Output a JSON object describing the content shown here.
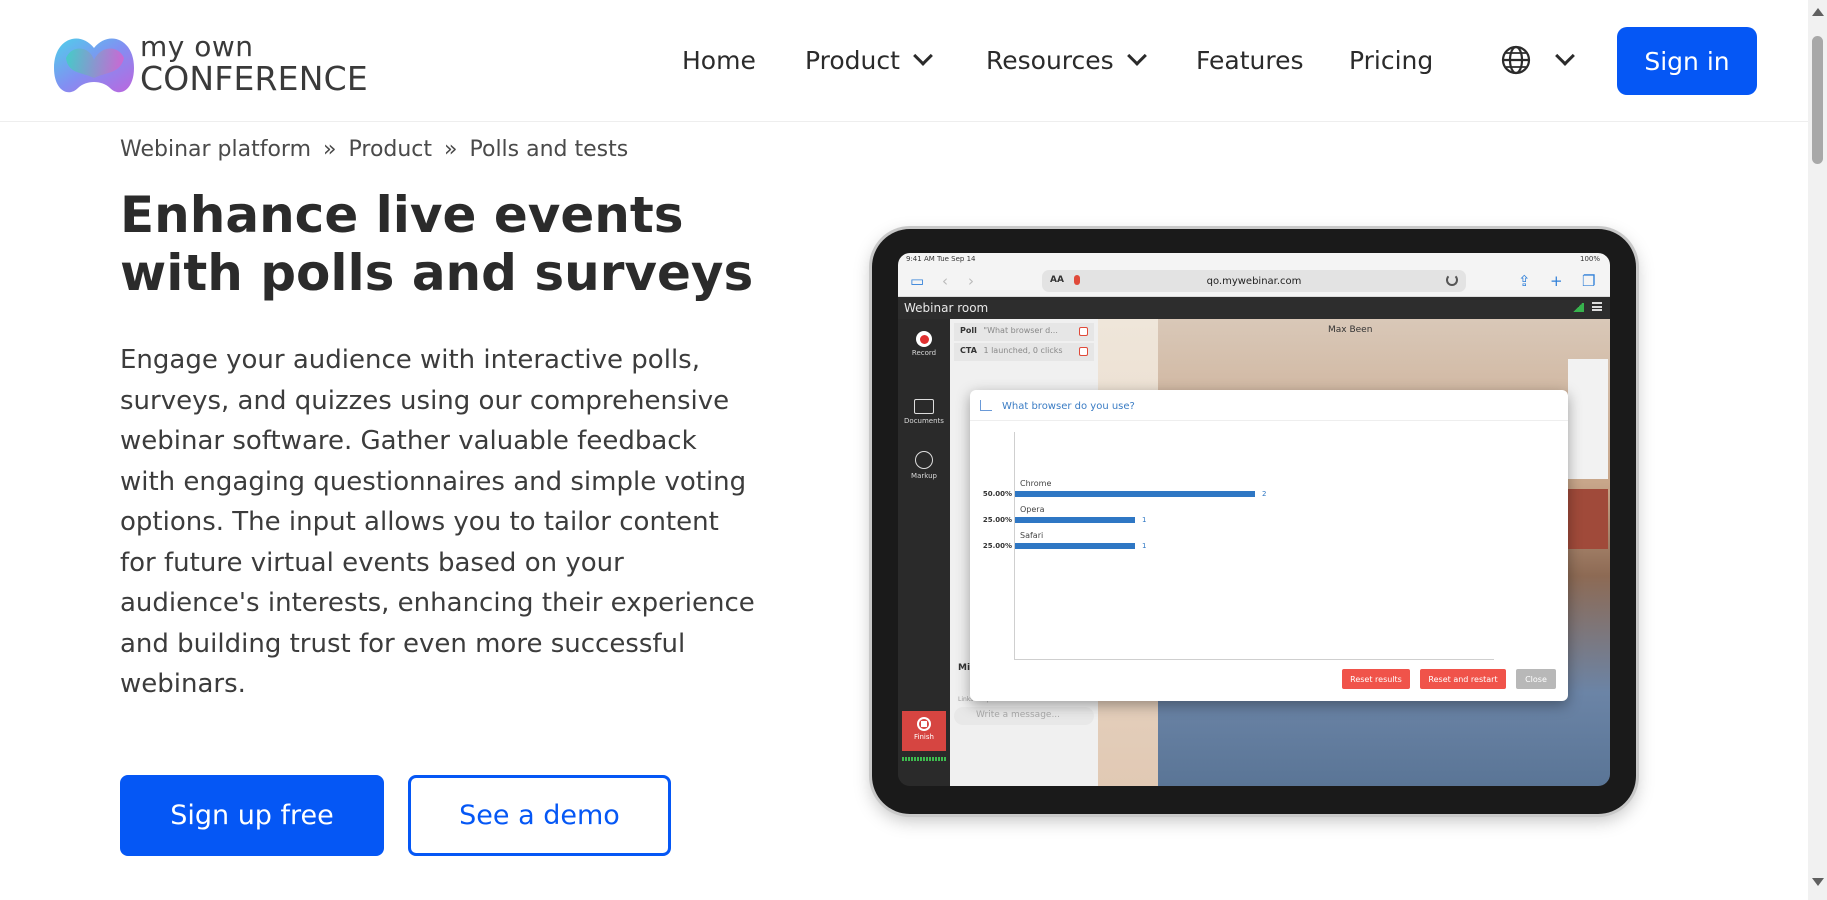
{
  "header": {
    "logo": {
      "line1": "my own",
      "line2": "CONFERENCE"
    },
    "nav": [
      {
        "label": "Home",
        "has_dropdown": false
      },
      {
        "label": "Product",
        "has_dropdown": true
      },
      {
        "label": "Resources",
        "has_dropdown": true
      },
      {
        "label": "Features",
        "has_dropdown": false
      },
      {
        "label": "Pricing",
        "has_dropdown": false
      }
    ],
    "language_icon": "globe-icon",
    "signin_label": "Sign in",
    "accent_color": "#0557f5"
  },
  "breadcrumb": [
    "Webinar platform",
    "Product",
    "Polls and tests"
  ],
  "hero": {
    "title": "Enhance live events with polls and surveys",
    "description": "Engage your audience with interactive polls, surveys, and quizzes using our comprehensive webinar software. Gather valuable feedback with engaging questionnaires and simple voting options. The input allows you to tailor content for future virtual events based on your audience's interests, enhancing their experience and building trust for even more successful webinars.",
    "primary_cta": "Sign up free",
    "secondary_cta": "See a demo"
  },
  "tablet": {
    "status_time": "9:41 AM   Tue Sep 14",
    "status_battery": "100%",
    "url_aa": "AA",
    "url": "qo.mywebinar.com",
    "room_title": "Webinar room",
    "sidebar": {
      "record": "Record",
      "documents": "Documents",
      "markup": "Markup",
      "finish": "Finish"
    },
    "panel": {
      "poll_row": {
        "tag": "Poll",
        "text": "\"What browser d..."
      },
      "cta_row": {
        "tag": "CTA",
        "text": "1 launched, 0 clicks"
      },
      "user": "Mike",
      "links_note": "Links are prohibited",
      "message_placeholder": "Write a message..."
    },
    "speaker_name": "Max Been",
    "poll_dialog": {
      "title": "What browser do you use?",
      "buttons": {
        "reset_results": "Reset results",
        "reset_restart": "Reset and restart",
        "close": "Close"
      }
    }
  },
  "chart_data": {
    "type": "bar",
    "orientation": "horizontal",
    "title": "What browser do you use?",
    "categories": [
      "Chrome",
      "Opera",
      "Safari"
    ],
    "values": [
      2,
      1,
      1
    ],
    "percent_labels": [
      "50.00%",
      "25.00%",
      "25.00%"
    ],
    "max": 2,
    "color": "#2f77c4"
  }
}
